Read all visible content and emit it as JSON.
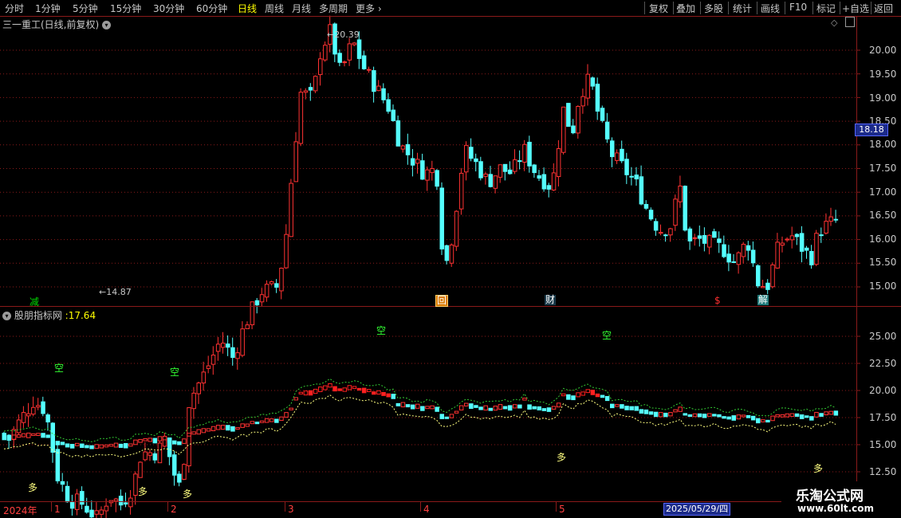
{
  "toolbar": {
    "periods": [
      "分时",
      "1分钟",
      "5分钟",
      "15分钟",
      "30分钟",
      "60分钟",
      "日线",
      "周线",
      "月线",
      "多周期",
      "更多"
    ],
    "active_period": "日线",
    "right_tools": [
      "复权",
      "叠加",
      "多股",
      "统计",
      "画线",
      "F10",
      "标记",
      "+自选",
      "返回"
    ]
  },
  "chart": {
    "title": "三一重工(日线,前复权)",
    "high_label": "20.39",
    "low_label": "14.87",
    "current_price": "18.18",
    "price_ticks": [
      "20.00",
      "19.50",
      "19.00",
      "18.50",
      "18.00",
      "17.50",
      "17.00",
      "16.50",
      "16.00",
      "15.50",
      "15.00"
    ],
    "events": [
      {
        "label": "减",
        "color": "#00dd00",
        "bg": "#1a4a1a"
      },
      {
        "label": "回",
        "color": "#ffffff",
        "bg": "#d97a00"
      },
      {
        "label": "财",
        "color": "#ffffff",
        "bg": "#1a3a4a"
      },
      {
        "label": "$",
        "color": "#ff3030",
        "bg": "#000000"
      },
      {
        "label": "解",
        "color": "#ffffff",
        "bg": "#1f7a7a"
      }
    ]
  },
  "indicator": {
    "name": "股朋指标网",
    "value": "17.64",
    "ticks": [
      "25.00",
      "22.50",
      "20.00",
      "17.50",
      "15.00",
      "12.50"
    ],
    "signals_kong": [
      "空",
      "空",
      "空",
      "空"
    ],
    "signals_duo": [
      "多",
      "多",
      "多",
      "多",
      "多"
    ]
  },
  "date_axis": {
    "labels": [
      "2024年",
      "1",
      "2",
      "3",
      "4",
      "5"
    ],
    "selected_date": "2025/05/29/四"
  },
  "watermark": {
    "line1": "乐淘公式网",
    "line2": "www.60lt.com"
  },
  "colors": {
    "up": "#ff3232",
    "down": "#54ffff",
    "ma": "#ffff80",
    "bg": "#000000",
    "grid": "#8b1a1a"
  }
}
